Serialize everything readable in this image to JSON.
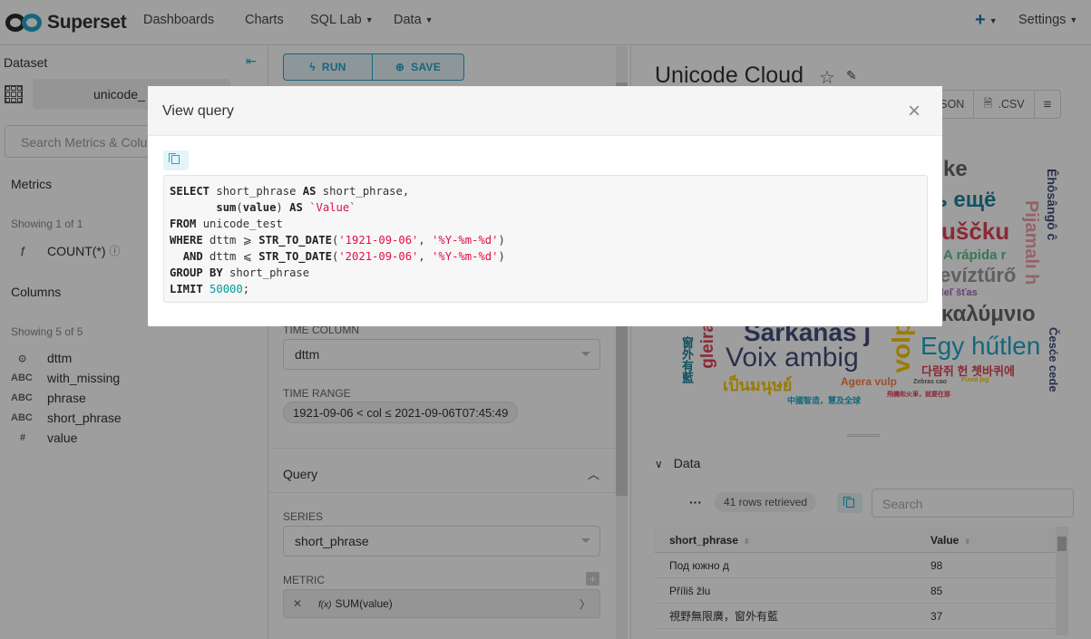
{
  "navbar": {
    "brand": "Superset",
    "items": [
      "Dashboards",
      "Charts",
      "SQL Lab",
      "Data"
    ],
    "plus": "+",
    "settings": "Settings"
  },
  "left_panel": {
    "title": "Dataset",
    "dataset_name": "unicode_",
    "search_placeholder": "Search Metrics & Colu",
    "metrics_label": "Metrics",
    "metrics_showing": "Showing 1 of 1",
    "metric_items": [
      {
        "type": "ƒ",
        "name": "COUNT(*)"
      }
    ],
    "columns_label": "Columns",
    "columns_showing": "Showing 5 of 5",
    "column_items": [
      {
        "type": "⊙",
        "name": "dttm"
      },
      {
        "type": "ABC",
        "name": "with_missing"
      },
      {
        "type": "ABC",
        "name": "phrase"
      },
      {
        "type": "ABC",
        "name": "short_phrase"
      },
      {
        "type": "#",
        "name": "value"
      }
    ]
  },
  "middle_panel": {
    "run_label": "RUN",
    "save_label": "SAVE",
    "time_column_label": "TIME COLUMN",
    "time_column_value": "dttm",
    "time_range_label": "TIME RANGE",
    "time_range_value": "1921-09-06 < col ≤ 2021-09-06T07:45:49",
    "query_section": "Query",
    "series_label": "SERIES",
    "series_value": "short_phrase",
    "metric_label": "METRIC",
    "metric_value": "SUM(value)"
  },
  "right_panel": {
    "chart_title": "Unicode Cloud",
    "export_json": "JSON",
    "export_csv": ".CSV",
    "data_label": "Data",
    "rows_retrieved": "41 rows retrieved",
    "search_placeholder": "Search",
    "table": {
      "columns": [
        "short_phrase",
        "Value"
      ],
      "rows": [
        [
          "Под южно д",
          "98"
        ],
        [
          "Příliš žlu",
          "85"
        ],
        [
          "視野無限廣，窗外有藍",
          "37"
        ]
      ]
    },
    "wordcloud_words": [
      {
        "text": "ke",
        "color": "#666666"
      },
      {
        "text": "ь ещё",
        "color": "#1a85a0"
      },
      {
        "text": "uščku",
        "color": "#e04355"
      },
      {
        "text": "A rápida r",
        "color": "#5ac189"
      },
      {
        "text": "evíztűrő",
        "color": "#999999"
      },
      {
        "text": "deľ šťas",
        "color": "#a868b7"
      },
      {
        "text": "καλύμνιο",
        "color": "#666666"
      },
      {
        "text": "Sarkanās j",
        "color": "#454e7c"
      },
      {
        "text": "Voix ambig",
        "color": "#454e7c"
      },
      {
        "text": "Egy hűtlen",
        "color": "#1fa8c9"
      },
      {
        "text": "다람쥐 헌 쳇바퀴에",
        "color": "#e04355"
      },
      {
        "text": "เป็นมนุษย์",
        "color": "#fcc700"
      },
      {
        "text": "Agera vulp",
        "color": "#ff7f44"
      },
      {
        "text": "Zebras cao",
        "color": "#666666"
      },
      {
        "text": "Fixed jeg",
        "color": "#fcc700"
      },
      {
        "text": "中國智造，慧及全球",
        "color": "#1fa8c9"
      },
      {
        "text": "飛機和火車，就要在那",
        "color": "#e04355"
      },
      {
        "text": "Êhôsângô ĉ",
        "color": "#454e7c"
      },
      {
        "text": "Pijamalı h",
        "color": "#efa1aa"
      },
      {
        "text": "Česće cede",
        "color": "#454e7c"
      },
      {
        "text": "gleira",
        "color": "#e04355"
      },
      {
        "text": "窗外有藍",
        "color": "#1a85a0"
      },
      {
        "text": "volp",
        "color": "#fcc700"
      }
    ]
  },
  "modal": {
    "title": "View query",
    "close": "×",
    "sql_lines": [
      [
        {
          "k": "kw",
          "t": "SELECT"
        },
        {
          "k": "",
          "t": " short_phrase "
        },
        {
          "k": "kw",
          "t": "AS"
        },
        {
          "k": "",
          "t": " short_phrase,"
        }
      ],
      [
        {
          "k": "",
          "t": "       "
        },
        {
          "k": "kw",
          "t": "sum"
        },
        {
          "k": "",
          "t": "("
        },
        {
          "k": "kw",
          "t": "value"
        },
        {
          "k": "",
          "t": ") "
        },
        {
          "k": "kw",
          "t": "AS"
        },
        {
          "k": "",
          "t": " "
        },
        {
          "k": "str",
          "t": "`Value`"
        }
      ],
      [
        {
          "k": "kw",
          "t": "FROM"
        },
        {
          "k": "",
          "t": " unicode_test"
        }
      ],
      [
        {
          "k": "kw",
          "t": "WHERE"
        },
        {
          "k": "",
          "t": " dttm ⩾ "
        },
        {
          "k": "kw",
          "t": "STR_TO_DATE"
        },
        {
          "k": "",
          "t": "("
        },
        {
          "k": "str",
          "t": "'1921-09-06'"
        },
        {
          "k": "",
          "t": ", "
        },
        {
          "k": "str",
          "t": "'%Y-%m-%d'"
        },
        {
          "k": "",
          "t": ")"
        }
      ],
      [
        {
          "k": "",
          "t": "  "
        },
        {
          "k": "kw",
          "t": "AND"
        },
        {
          "k": "",
          "t": " dttm ⩽ "
        },
        {
          "k": "kw",
          "t": "STR_TO_DATE"
        },
        {
          "k": "",
          "t": "("
        },
        {
          "k": "str",
          "t": "'2021-09-06'"
        },
        {
          "k": "",
          "t": ", "
        },
        {
          "k": "str",
          "t": "'%Y-%m-%d'"
        },
        {
          "k": "",
          "t": ")"
        }
      ],
      [
        {
          "k": "kw",
          "t": "GROUP BY"
        },
        {
          "k": "",
          "t": " short_phrase"
        }
      ],
      [
        {
          "k": "kw",
          "t": "LIMIT"
        },
        {
          "k": "",
          "t": " "
        },
        {
          "k": "num",
          "t": "50000"
        },
        {
          "k": "",
          "t": ";"
        }
      ]
    ]
  },
  "colors": {
    "accent": "#20a7c9",
    "text": "#333333"
  }
}
